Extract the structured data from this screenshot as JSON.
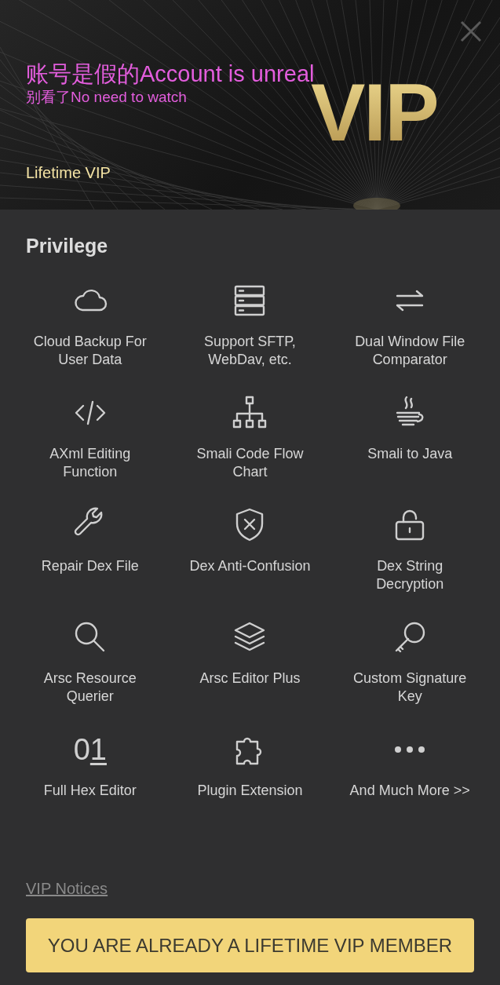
{
  "header": {
    "title": "账号是假的Account is unreal",
    "subtitle": "别看了No need to watch",
    "badge": "VIP",
    "plan": "Lifetime VIP"
  },
  "section": {
    "title": "Privilege"
  },
  "features": [
    {
      "label": "Cloud Backup For User Data"
    },
    {
      "label": "Support SFTP, WebDav, etc."
    },
    {
      "label": "Dual Window File Comparator"
    },
    {
      "label": "AXml Editing Function"
    },
    {
      "label": "Smali Code Flow Chart"
    },
    {
      "label": "Smali to Java"
    },
    {
      "label": "Repair Dex File"
    },
    {
      "label": "Dex Anti-Confusion"
    },
    {
      "label": "Dex String Decryption"
    },
    {
      "label": "Arsc Resource Querier"
    },
    {
      "label": "Arsc Editor Plus"
    },
    {
      "label": "Custom Signature Key"
    },
    {
      "icon_text": "01",
      "label": "Full Hex Editor"
    },
    {
      "label": "Plugin Extension"
    },
    {
      "label": "And Much More >>"
    }
  ],
  "notices_link": "VIP Notices",
  "action_button": "YOU ARE ALREADY A LIFETIME VIP MEMBER"
}
